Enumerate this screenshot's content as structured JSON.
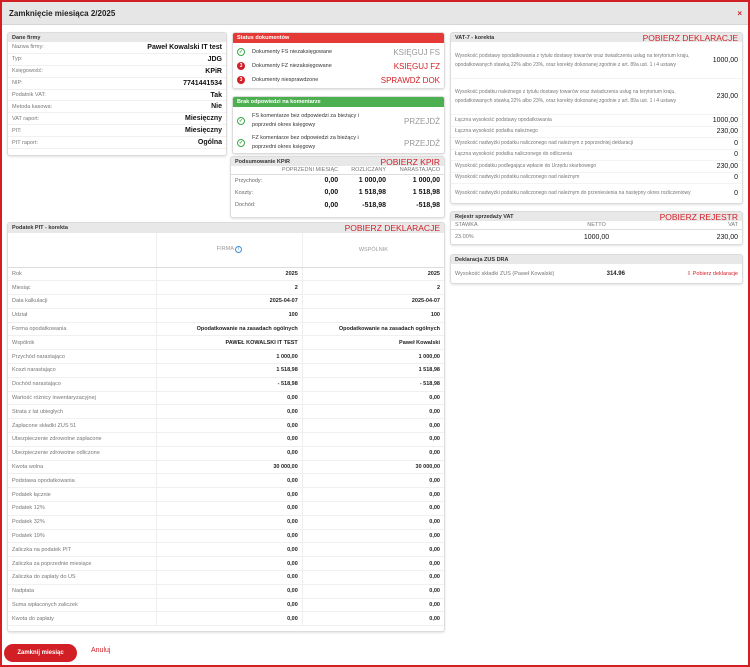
{
  "dialog": {
    "title": "Zamknięcie miesiąca 2/2025",
    "close": "×"
  },
  "company": {
    "header": "Dane firmy",
    "rows": [
      {
        "label": "Nazwa firmy:",
        "value": "Paweł Kowalski IT test"
      },
      {
        "label": "Typ:",
        "value": "JDG"
      },
      {
        "label": "Księgowość:",
        "value": "KPiR"
      },
      {
        "label": "NIP:",
        "value": "7741441534"
      },
      {
        "label": "Podatnik VAT:",
        "value": "Tak"
      },
      {
        "label": "Metoda kasowa:",
        "value": "Nie"
      },
      {
        "label": "VAT raport:",
        "value": "Miesięczny"
      },
      {
        "label": "PIT:",
        "value": "Miesięczny"
      },
      {
        "label": "PIT raport:",
        "value": "Ogólna"
      }
    ]
  },
  "doc_status": {
    "header": "Status dokumentów",
    "header_color": "#e53935",
    "rows": [
      {
        "icon": "check-circle-icon",
        "glyph": "✓",
        "state": "ok",
        "text": "Dokumenty FS niezaksięgowane",
        "action": "KSIĘGUJ FS",
        "action_style": "gray"
      },
      {
        "icon": "number-badge-icon",
        "glyph": "3",
        "state": "bad",
        "text": "Dokumenty FZ niezaksięgowane",
        "action": "KSIĘGUJ FZ",
        "action_style": "red"
      },
      {
        "icon": "number-badge-icon",
        "glyph": "3",
        "state": "bad",
        "text": "Dokumenty niesprawdzone",
        "action": "SPRAWDŹ DOK",
        "action_style": "red"
      }
    ]
  },
  "comments": {
    "header": "Brak odpowiedzi na komentarze",
    "header_color": "#4caf50",
    "rows": [
      {
        "icon": "check-circle-icon",
        "glyph": "✓",
        "text": "FS komentarze bez odpowiedzi za bieżący i poprzedni okres księgowy",
        "action": "PRZEJDŹ"
      },
      {
        "icon": "check-circle-icon",
        "glyph": "✓",
        "text": "FZ komentarze bez odpowiedzi za bieżący i poprzedni okres księgowy",
        "action": "PRZEJDŹ"
      }
    ]
  },
  "kpir": {
    "header": "Podsumowanie KPiR",
    "link": "POBIERZ KPIR",
    "cols": [
      "POPRZEDNI MIESIĄC",
      "ROZLICZANY",
      "NARASTAJĄCO"
    ],
    "rows": [
      {
        "label": "Przychody:",
        "v": [
          "0,00",
          "1 000,00",
          "1 000,00"
        ]
      },
      {
        "label": "Koszty:",
        "v": [
          "0,00",
          "1 518,98",
          "1 518,98"
        ]
      },
      {
        "label": "Dochód:",
        "v": [
          "0,00",
          "-518,98",
          "-518,98"
        ]
      }
    ]
  },
  "vat7": {
    "header": "VAT-7 - korekta",
    "link": "POBIERZ DEKLARACJE",
    "rows": [
      {
        "label": "Wysokość podstawy opodatkowania z tytułu dostawy towarów oraz świadczenia usług na terytorium kraju, opodatkowanych stawką 22% albo 23%, oraz korekty dokonanej zgodnie z art. 89a ust. 1 i 4 ustawy",
        "value": "1000,00",
        "lines": 3
      },
      {
        "label": "Wysokość podatku należnego z tytułu dostawy towarów oraz świadczenia usług na terytorium kraju, opodatkowanych stawką 22% albo 23%, oraz korekty dokonanej zgodnie z art. 89a ust. 1 i 4 ustawy",
        "value": "230,00",
        "lines": 3
      },
      {
        "label": "Łączna wysokość podstawy opodatkowania",
        "value": "1000,00",
        "lines": 1
      },
      {
        "label": "Łączna wysokość podatku należnego",
        "value": "230,00",
        "lines": 1
      },
      {
        "label": "Wysokość nadwyżki podatku naliczonego nad należnym z poprzedniej deklaracji",
        "value": "0",
        "lines": 1
      },
      {
        "label": "Łączna wysokość podatku naliczonego do odliczenia",
        "value": "0",
        "lines": 1
      },
      {
        "label": "Wysokość podatku podlegająca wpłacie do Urzędu skarbowego",
        "value": "230,00",
        "lines": 1
      },
      {
        "label": "Wysokość nadwyżki podatku naliczonego nad należnym",
        "value": "0",
        "lines": 1
      },
      {
        "label": "Wysokość nadwyżki podatku naliczonego nad należnym do przeniesienia na następny okres rozliczeniowy",
        "value": "0",
        "lines": 2
      }
    ]
  },
  "vat_register": {
    "header": "Rejestr sprzedaży VAT",
    "link": "POBIERZ REJESTR",
    "cols": [
      "STAWKA",
      "NETTO",
      "VAT"
    ],
    "rows": [
      {
        "v": [
          "23.00%",
          "1000,00",
          "230,00"
        ]
      }
    ]
  },
  "zus": {
    "header": "Deklaracja ZUS DRA",
    "label": "Wysokość składki ZUS (Paweł Kowalski)",
    "value": "314.96",
    "link": "Pobierz deklaracje",
    "icon": "download-icon"
  },
  "pit": {
    "header": "Podatek PIT - korekta",
    "link": "POBIERZ DEKLARACJE",
    "col_firm": "FIRMA",
    "col_partner": "WSPÓLNIK",
    "info_icon": "info-icon",
    "rows": [
      {
        "label": "Rok",
        "a": "2025",
        "b": "2025"
      },
      {
        "label": "Miesiąc",
        "a": "2",
        "b": "2"
      },
      {
        "label": "Data kalkulacji",
        "a": "2025-04-07",
        "b": "2025-04-07"
      },
      {
        "label": "Udział",
        "a": "100",
        "b": "100"
      },
      {
        "label": "Forma opodatkowania",
        "a": "Opodatkowanie na zasadach ogólnych",
        "b": "Opodatkowanie na zasadach ogólnych"
      },
      {
        "label": "Wspólnik",
        "a": "PAWEŁ KOWALSKI IT TEST",
        "b": "Paweł Kowalski"
      },
      {
        "label": "Przychód narastająco",
        "a": "1 000,00",
        "b": "1 000,00"
      },
      {
        "label": "Koszt narastająco",
        "a": "1 518,98",
        "b": "1 518,98"
      },
      {
        "label": "Dochód narastająco",
        "a": "- 518,98",
        "b": "- 518,98"
      },
      {
        "label": "Wartość różnicy inwentaryzacyjnej",
        "a": "0,00",
        "b": "0,00"
      },
      {
        "label": "Strata z lat ubiegłych",
        "a": "0,00",
        "b": "0,00"
      },
      {
        "label": "Zapłacone składki ZUS 51",
        "a": "0,00",
        "b": "0,00"
      },
      {
        "label": "Ubezpieczenie zdrowotne zapłacone",
        "a": "0,00",
        "b": "0,00"
      },
      {
        "label": "Ubezpieczenie zdrowotne odliczone",
        "a": "0,00",
        "b": "0,00"
      },
      {
        "label": "Kwota wolna",
        "a": "30 000,00",
        "b": "30 000,00"
      },
      {
        "label": "Podstawa opodatkowania",
        "a": "0,00",
        "b": "0,00"
      },
      {
        "label": "Podatek łącznie",
        "a": "0,00",
        "b": "0,00"
      },
      {
        "label": "Podatek 12%",
        "a": "0,00",
        "b": "0,00"
      },
      {
        "label": "Podatek 32%",
        "a": "0,00",
        "b": "0,00"
      },
      {
        "label": "Podatek 19%",
        "a": "0,00",
        "b": "0,00"
      },
      {
        "label": "Zaliczka na podatek PIT",
        "a": "0,00",
        "b": "0,00"
      },
      {
        "label": "Zaliczka za poprzednie miesiące",
        "a": "0,00",
        "b": "0,00"
      },
      {
        "label": "Zaliczka do zapłaty do US",
        "a": "0,00",
        "b": "0,00"
      },
      {
        "label": "Nadpłata",
        "a": "0,00",
        "b": "0,00"
      },
      {
        "label": "Suma wpłaconych zaliczek",
        "a": "0,00",
        "b": "0,00"
      },
      {
        "label": "Kwota do zapłaty",
        "a": "0,00",
        "b": "0,00"
      }
    ]
  },
  "footer": {
    "close_month": "Zamknij miesiąc",
    "cancel": "Anuluj"
  }
}
